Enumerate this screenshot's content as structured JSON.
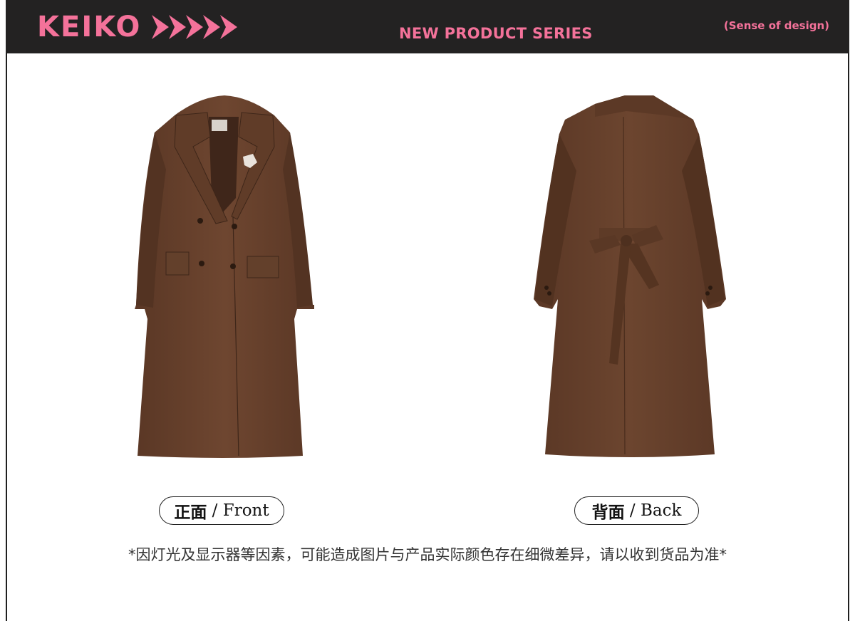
{
  "header": {
    "brand": "KEIKO",
    "arrows_icon": "double-arrow-strip-icon",
    "series_title": "NEW PRODUCT SERIES",
    "tagline": "(Sense of design)",
    "background_color": "#232222",
    "accent_color": "#f4729a"
  },
  "views": [
    {
      "label_cn": "正面",
      "label_sep": " / ",
      "label_en": "Front"
    },
    {
      "label_cn": "背面",
      "label_sep": " / ",
      "label_en": "Back"
    }
  ],
  "coat_color": "#6a432c",
  "disclaimer": "*因灯光及显示器等因素，可能造成图片与产品实际颜色存在细微差异，请以收到货品为准*"
}
